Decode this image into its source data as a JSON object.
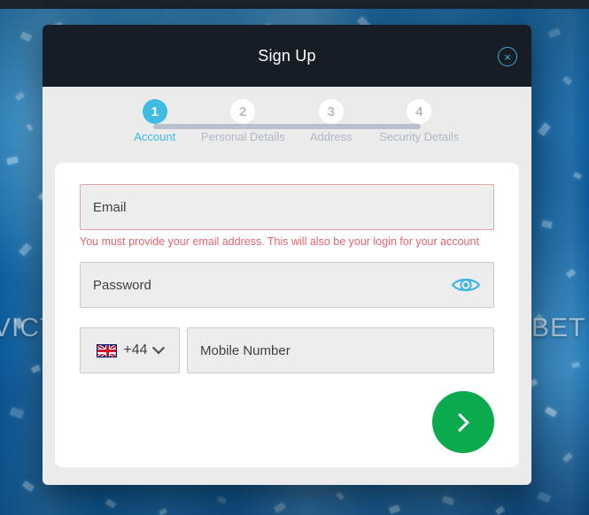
{
  "background": {
    "brand_left": "VICTO",
    "brand_right": "BET V"
  },
  "modal": {
    "header": {
      "title": "Sign Up",
      "close_label": "×"
    },
    "stepper": {
      "steps": [
        {
          "number": "1",
          "label": "Account",
          "state": "active"
        },
        {
          "number": "2",
          "label": "Personal Details",
          "state": "inactive"
        },
        {
          "number": "3",
          "label": "Address",
          "state": "inactive"
        },
        {
          "number": "4",
          "label": "Security Details",
          "state": "inactive"
        }
      ]
    },
    "form": {
      "email": {
        "value": "",
        "placeholder": "Email",
        "error": "You must provide your email address. This will also be your login for your account"
      },
      "password": {
        "value": "",
        "placeholder": "Password",
        "toggle_icon": "eye-icon"
      },
      "country": {
        "flag": "uk-flag-icon",
        "dial_code": "+44",
        "chevron": "chevron-down-icon"
      },
      "mobile": {
        "value": "",
        "placeholder": "Mobile Number"
      },
      "next_button": {
        "icon": "chevron-right-icon",
        "label": ""
      }
    }
  },
  "colors": {
    "accent_blue": "#3fbbe4",
    "header_dark": "#161d27",
    "error_red": "#e2656f",
    "next_green": "#0caa4e",
    "field_bg": "#ededee",
    "panel_gray": "#ebebeb"
  }
}
